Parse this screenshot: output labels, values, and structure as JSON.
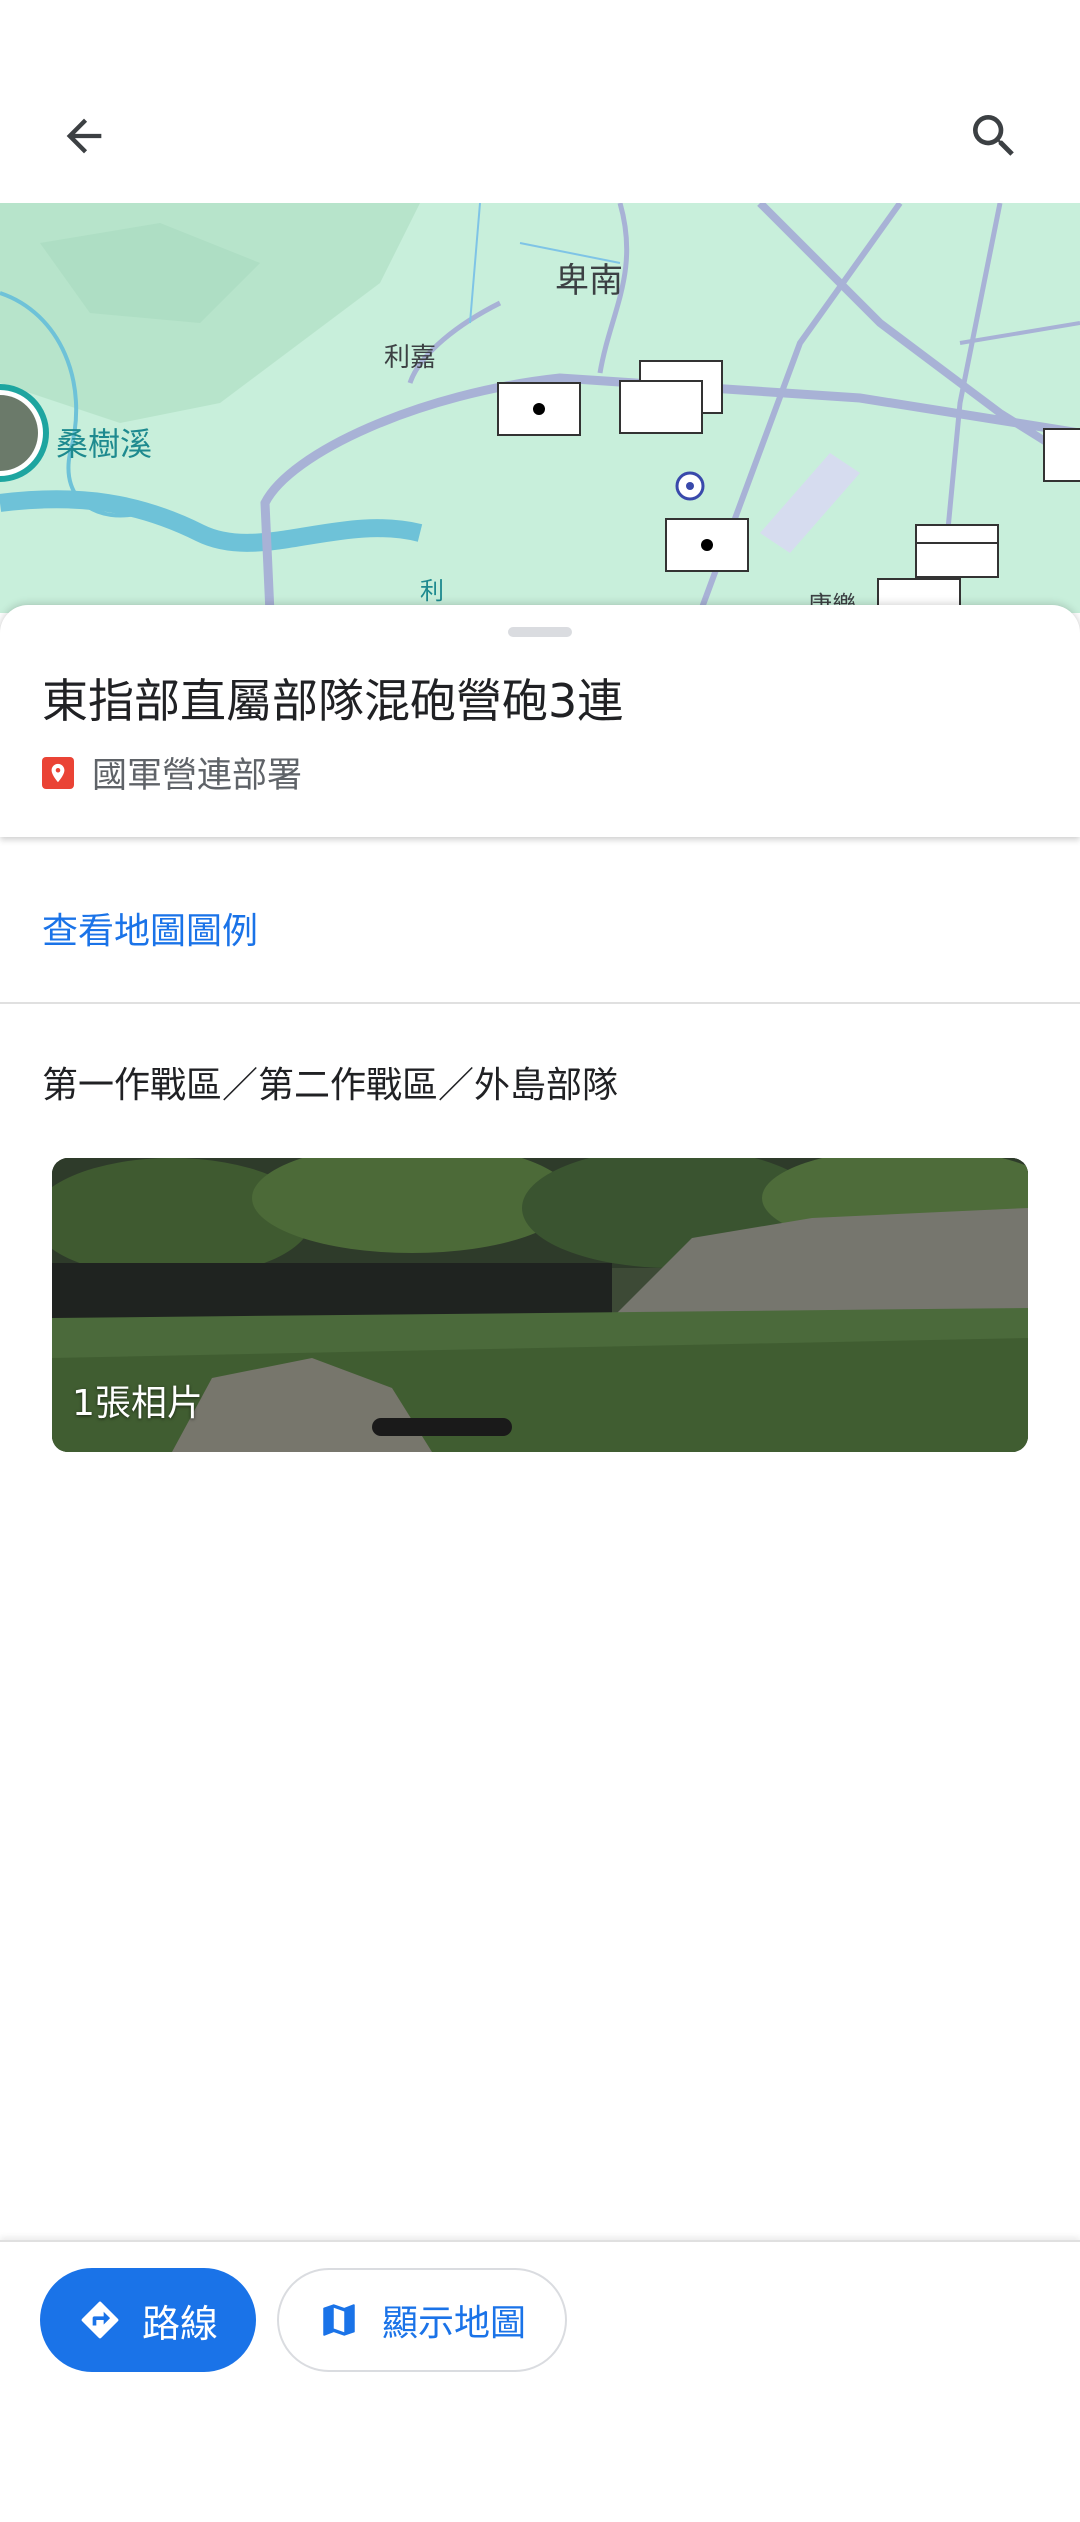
{
  "toolbar": {
    "back_icon": "arrow-back-icon",
    "search_icon": "search-icon"
  },
  "map": {
    "labels": {
      "beinan": "卑南",
      "lijia": "利嘉",
      "sangshuxi": "桑樹溪",
      "kangle": "康樂",
      "river": "利"
    },
    "colors": {
      "land": "#c8efdb",
      "road": "#a8b2d6",
      "water": "#6ec2d8"
    }
  },
  "place": {
    "title": "東指部直屬部隊混砲營砲3連",
    "category": "國軍營連部署",
    "category_icon": "map-pin-icon",
    "category_color": "#ea4335"
  },
  "legend_link": "查看地圖圖例",
  "regions": "第一作戰區／第二作戰區／外島部隊",
  "photos": {
    "count_label": "1張相片"
  },
  "actions": {
    "route_label": "路線",
    "route_icon": "directions-icon",
    "show_map_label": "顯示地圖",
    "show_map_icon": "map-icon",
    "accent": "#1a73e8"
  }
}
